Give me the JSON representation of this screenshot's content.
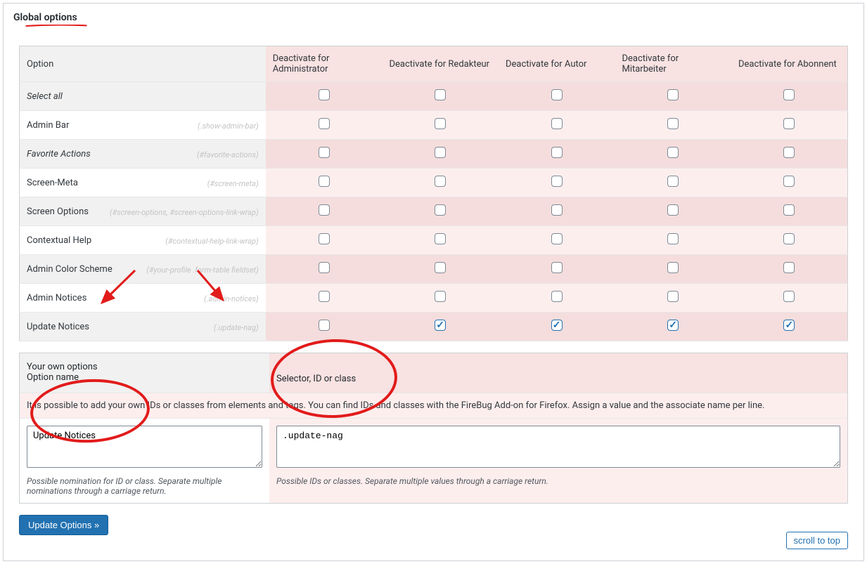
{
  "panel_title": "Global options",
  "columns": {
    "option": "Option",
    "roles": [
      "Deactivate for Administrator",
      "Deactivate for Redakteur",
      "Deactivate for Autor",
      "Deactivate for Mitarbeiter",
      "Deactivate for Abonnent"
    ]
  },
  "rows": [
    {
      "label": "Select all",
      "slug": "",
      "italic": true,
      "checks": [
        false,
        false,
        false,
        false,
        false
      ]
    },
    {
      "label": "Admin Bar",
      "slug": "(.show-admin-bar)",
      "checks": [
        false,
        false,
        false,
        false,
        false
      ]
    },
    {
      "label": "Favorite Actions",
      "slug": "(#favorite-actions)",
      "italic": true,
      "checks": [
        false,
        false,
        false,
        false,
        false
      ]
    },
    {
      "label": "Screen-Meta",
      "slug": "(#screen-meta)",
      "checks": [
        false,
        false,
        false,
        false,
        false
      ]
    },
    {
      "label": "Screen Options",
      "slug": "(#screen-options, #screen-options-link-wrap)",
      "checks": [
        false,
        false,
        false,
        false,
        false
      ]
    },
    {
      "label": "Contextual Help",
      "slug": "(#contextual-help-link-wrap)",
      "checks": [
        false,
        false,
        false,
        false,
        false
      ]
    },
    {
      "label": "Admin Color Scheme",
      "slug": "(#your-profile .form-table fieldset)",
      "checks": [
        false,
        false,
        false,
        false,
        false
      ]
    },
    {
      "label": "Admin Notices",
      "slug": "(.admin-notices)",
      "checks": [
        false,
        false,
        false,
        false,
        false
      ]
    },
    {
      "label": "Update Notices",
      "slug": "(.update-nag)",
      "checks": [
        false,
        true,
        true,
        true,
        true
      ]
    }
  ],
  "own": {
    "heading": "Your own options",
    "name_label": "Option name",
    "selector_label": "Selector, ID or class",
    "desc": "It is possible to add your own IDs or classes from elements and tags. You can find IDs and classes with the FireBug Add-on for Firefox. Assign a value and the associate name per line.",
    "name_value": "Update Notices",
    "selector_value": ".update-nag",
    "name_hint": "Possible nomination for ID or class. Separate multiple nominations through a carriage return.",
    "selector_hint": "Possible IDs or classes. Separate multiple values through a carriage return."
  },
  "buttons": {
    "update": "Update Options »",
    "scroll": "scroll to top"
  }
}
